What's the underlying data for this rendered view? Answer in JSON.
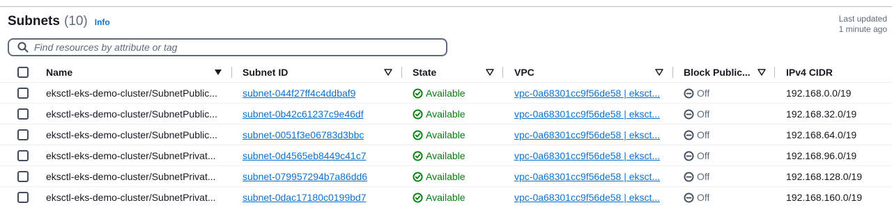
{
  "header": {
    "title": "Subnets",
    "count": "(10)",
    "info_label": "Info",
    "last_updated_line1": "Last updated",
    "last_updated_line2": "1 minute ago"
  },
  "search": {
    "placeholder": "Find resources by attribute or tag",
    "value": ""
  },
  "columns": [
    "Name",
    "Subnet ID",
    "State",
    "VPC",
    "Block Public...",
    "IPv4 CIDR"
  ],
  "rows": [
    {
      "name": "eksctl-eks-demo-cluster/SubnetPublic...",
      "subnet_id": "subnet-044f27ff4c4ddbaf9",
      "state": "Available",
      "vpc": "vpc-0a68301cc9f56de58 | eksct...",
      "block_public": "Off",
      "ipv4_cidr": "192.168.0.0/19"
    },
    {
      "name": "eksctl-eks-demo-cluster/SubnetPublic...",
      "subnet_id": "subnet-0b42c61237c9e46df",
      "state": "Available",
      "vpc": "vpc-0a68301cc9f56de58 | eksct...",
      "block_public": "Off",
      "ipv4_cidr": "192.168.32.0/19"
    },
    {
      "name": "eksctl-eks-demo-cluster/SubnetPublic...",
      "subnet_id": "subnet-0051f3e06783d3bbc",
      "state": "Available",
      "vpc": "vpc-0a68301cc9f56de58 | eksct...",
      "block_public": "Off",
      "ipv4_cidr": "192.168.64.0/19"
    },
    {
      "name": "eksctl-eks-demo-cluster/SubnetPrivat...",
      "subnet_id": "subnet-0d4565eb8449c41c7",
      "state": "Available",
      "vpc": "vpc-0a68301cc9f56de58 | eksct...",
      "block_public": "Off",
      "ipv4_cidr": "192.168.96.0/19"
    },
    {
      "name": "eksctl-eks-demo-cluster/SubnetPrivat...",
      "subnet_id": "subnet-079957294b7a86dd6",
      "state": "Available",
      "vpc": "vpc-0a68301cc9f56de58 | eksct...",
      "block_public": "Off",
      "ipv4_cidr": "192.168.128.0/19"
    },
    {
      "name": "eksctl-eks-demo-cluster/SubnetPrivat...",
      "subnet_id": "subnet-0dac17180c0199bd7",
      "state": "Available",
      "vpc": "vpc-0a68301cc9f56de58 | eksct...",
      "block_public": "Off",
      "ipv4_cidr": "192.168.160.0/19"
    }
  ],
  "icons": {
    "search": "search-icon",
    "sort": "caret-down-icon",
    "available": "check-circle-icon",
    "off": "minus-circle-icon"
  },
  "colors": {
    "link": "#0972d3",
    "success": "#037f0c",
    "muted": "#5f6b7a",
    "text": "#16191f"
  }
}
